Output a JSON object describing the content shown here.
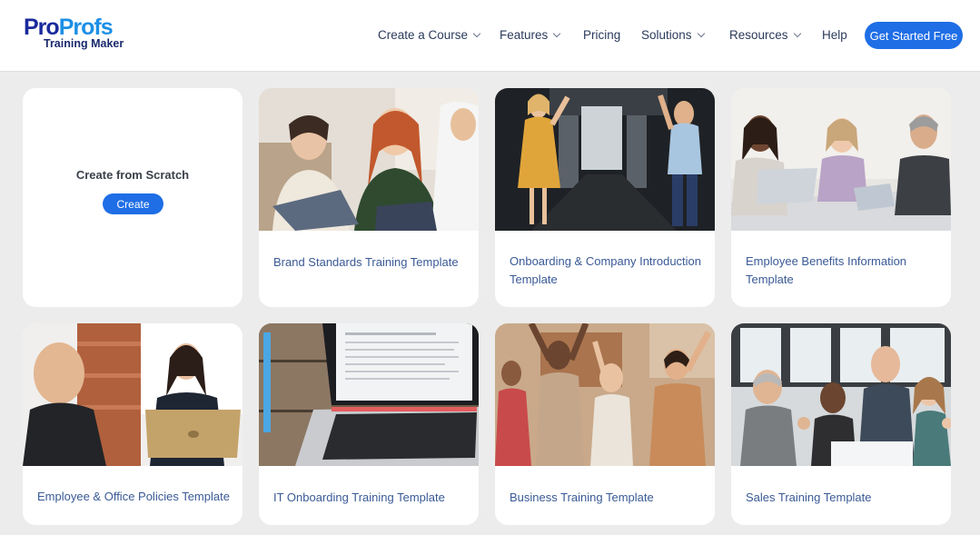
{
  "brand": {
    "name_part1": "Pro",
    "name_part2": "Profs",
    "subtitle": "Training Maker"
  },
  "nav": {
    "items": [
      {
        "label": "Create a Course",
        "has_dropdown": true
      },
      {
        "label": "Features",
        "has_dropdown": true
      },
      {
        "label": "Pricing",
        "has_dropdown": false
      },
      {
        "label": "Solutions",
        "has_dropdown": true
      },
      {
        "label": "Resources",
        "has_dropdown": true
      },
      {
        "label": "Help",
        "has_dropdown": false
      }
    ],
    "cta_label": "Get Started Free"
  },
  "scratch": {
    "label": "Create from Scratch",
    "button_label": "Create"
  },
  "templates": [
    {
      "title": "Brand Standards Training Template",
      "image": "team-meeting-photo"
    },
    {
      "title": "Onboarding & Company Introduction Template",
      "image": "office-welcome-photo"
    },
    {
      "title": "Employee Benefits Information Template",
      "image": "discussion-table-photo"
    },
    {
      "title": "Employee & Office Policies Template",
      "image": "interview-laptop-photo"
    },
    {
      "title": "IT Onboarding Training Template",
      "image": "laptop-document-photo"
    },
    {
      "title": "Business Training Template",
      "image": "cheering-team-photo"
    },
    {
      "title": "Sales Training Template",
      "image": "thumbs-up-team-photo"
    }
  ],
  "colors": {
    "accent": "#1f6ee6",
    "background": "#ececec",
    "link": "#3a5a96",
    "logo_dark": "#1a2a9c",
    "logo_light": "#1c8fe6"
  }
}
